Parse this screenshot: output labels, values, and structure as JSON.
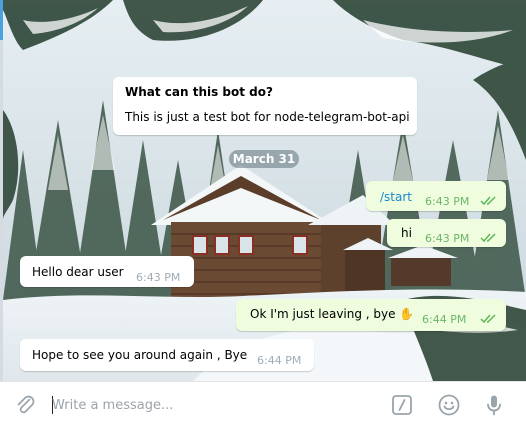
{
  "bot_info": {
    "title": "What can this bot do?",
    "description": "This is just a test bot for node-telegram-bot-api"
  },
  "date_divider": "March 31",
  "messages": [
    {
      "text": "/start",
      "time": "6:43 PM",
      "direction": "outgoing",
      "read": true
    },
    {
      "text": "hi",
      "time": "6:43 PM",
      "direction": "outgoing",
      "read": true
    },
    {
      "text": "Hello dear user",
      "time": "6:43 PM",
      "direction": "incoming"
    },
    {
      "text": "Ok I'm just leaving , bye ✋",
      "time": "6:44 PM",
      "direction": "outgoing",
      "read": true
    },
    {
      "text": "Hope to see you around again , Bye",
      "time": "6:44 PM",
      "direction": "incoming"
    }
  ],
  "composer": {
    "placeholder": "Write a message...",
    "value": ""
  },
  "icons": {
    "attach": "paperclip-icon",
    "commands": "slash-command-icon",
    "emoji": "emoji-smile-icon",
    "voice": "microphone-icon",
    "read_receipt": "double-check-icon"
  },
  "colors": {
    "incoming_bubble": "#ffffff",
    "outgoing_bubble": "#effdde",
    "outgoing_time": "#6cb56a",
    "command_link": "#168acd",
    "check": "#5fb75b"
  }
}
